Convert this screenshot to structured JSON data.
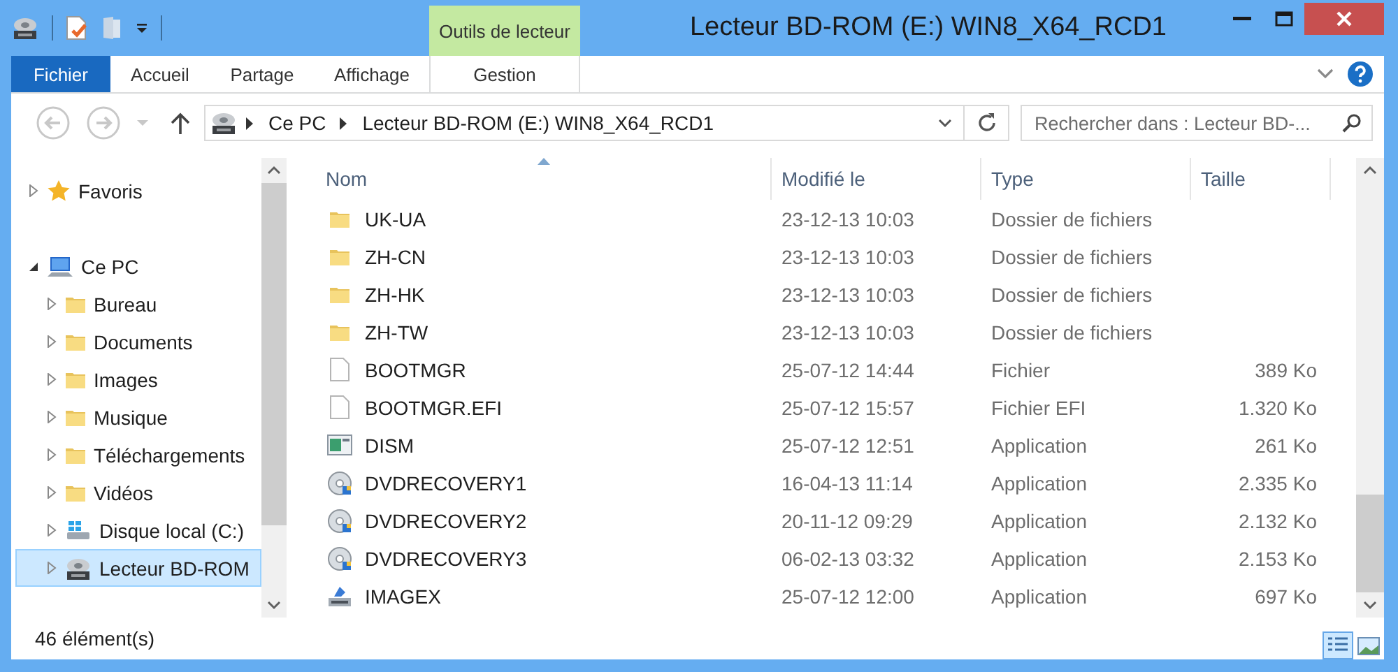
{
  "window": {
    "title": "Lecteur BD-ROM (E:) WIN8_X64_RCD1"
  },
  "ribbon": {
    "context_group": "Outils de lecteur",
    "tabs": [
      {
        "label": "Fichier",
        "kind": "file"
      },
      {
        "label": "Accueil",
        "kind": "tab"
      },
      {
        "label": "Partage",
        "kind": "tab"
      },
      {
        "label": "Affichage",
        "kind": "tab"
      },
      {
        "label": "Gestion",
        "kind": "context"
      }
    ]
  },
  "address": {
    "path": [
      "Ce PC",
      "Lecteur BD-ROM (E:) WIN8_X64_RCD1"
    ]
  },
  "search": {
    "placeholder": "Rechercher dans : Lecteur BD-..."
  },
  "nav": {
    "items": [
      {
        "label": "Favoris",
        "kind": "favorites",
        "expanded": false,
        "selected": false
      },
      {
        "label": "Ce PC",
        "kind": "computer",
        "expanded": true,
        "selected": false,
        "children": [
          {
            "label": "Bureau",
            "kind": "folder",
            "expanded": false,
            "selected": false
          },
          {
            "label": "Documents",
            "kind": "folder",
            "expanded": false,
            "selected": false
          },
          {
            "label": "Images",
            "kind": "folder",
            "expanded": false,
            "selected": false
          },
          {
            "label": "Musique",
            "kind": "folder",
            "expanded": false,
            "selected": false
          },
          {
            "label": "Téléchargements",
            "kind": "folder",
            "expanded": false,
            "selected": false
          },
          {
            "label": "Vidéos",
            "kind": "folder",
            "expanded": false,
            "selected": false
          },
          {
            "label": "Disque local (C:)",
            "kind": "drive",
            "expanded": false,
            "selected": false
          },
          {
            "label": "Lecteur BD-ROM",
            "kind": "optical",
            "expanded": false,
            "selected": true
          }
        ]
      }
    ]
  },
  "columns": [
    {
      "label": "Nom",
      "sorted": true
    },
    {
      "label": "Modifié le",
      "sorted": false
    },
    {
      "label": "Type",
      "sorted": false
    },
    {
      "label": "Taille",
      "sorted": false
    }
  ],
  "files": [
    {
      "name": "UK-UA",
      "modified": "23-12-13 10:03",
      "type": "Dossier de fichiers",
      "kind": "folder"
    },
    {
      "name": "ZH-CN",
      "modified": "23-12-13 10:03",
      "type": "Dossier de fichiers",
      "kind": "folder"
    },
    {
      "name": "ZH-HK",
      "modified": "23-12-13 10:03",
      "type": "Dossier de fichiers",
      "kind": "folder"
    },
    {
      "name": "ZH-TW",
      "modified": "23-12-13 10:03",
      "type": "Dossier de fichiers",
      "kind": "folder"
    },
    {
      "name": "BOOTMGR",
      "modified": "25-07-12 14:44",
      "type": "Fichier",
      "size": "389 Ko",
      "kind": "file"
    },
    {
      "name": "BOOTMGR.EFI",
      "modified": "25-07-12 15:57",
      "type": "Fichier EFI",
      "size": "1.320 Ko",
      "kind": "file"
    },
    {
      "name": "DISM",
      "modified": "25-07-12 12:51",
      "type": "Application",
      "size": "261 Ko",
      "kind": "app"
    },
    {
      "name": "DVDRECOVERY1",
      "modified": "16-04-13 11:14",
      "type": "Application",
      "size": "2.335 Ko",
      "kind": "disc"
    },
    {
      "name": "DVDRECOVERY2",
      "modified": "20-11-12 09:29",
      "type": "Application",
      "size": "2.132 Ko",
      "kind": "disc"
    },
    {
      "name": "DVDRECOVERY3",
      "modified": "06-02-13 03:32",
      "type": "Application",
      "size": "2.153 Ko",
      "kind": "disc"
    },
    {
      "name": "IMAGEX",
      "modified": "25-07-12 12:00",
      "type": "Application",
      "size": "697 Ko",
      "kind": "setup"
    }
  ],
  "status_bar": {
    "count": "46 élément(s)",
    "views": [
      {
        "kind": "details",
        "selected": true
      },
      {
        "kind": "large-icons",
        "selected": false
      }
    ]
  }
}
